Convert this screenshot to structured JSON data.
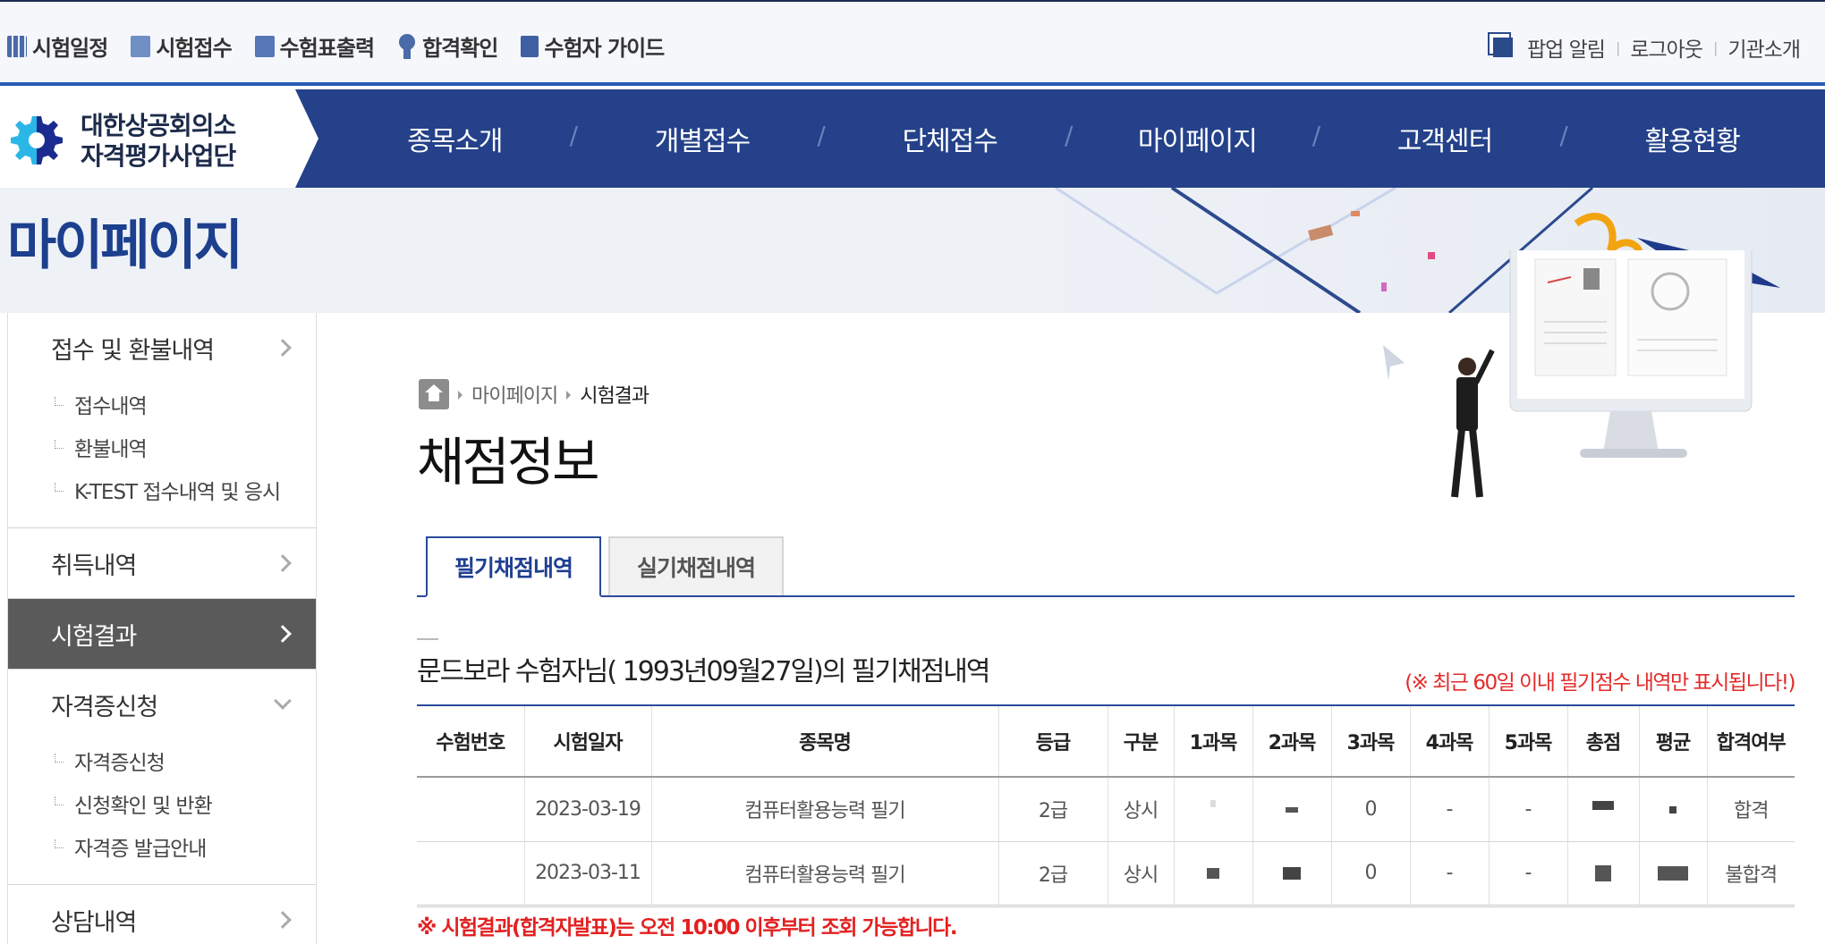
{
  "topbar": {
    "left_items": [
      {
        "label": "시험일정",
        "icon": "calendar-icon"
      },
      {
        "label": "시험접수",
        "icon": "pen-icon"
      },
      {
        "label": "수험표출력",
        "icon": "print-icon"
      },
      {
        "label": "합격확인",
        "icon": "ribbon-icon"
      },
      {
        "label": "수험자 가이드",
        "icon": "book-icon"
      }
    ],
    "right_items": [
      "팝업 알림",
      "로그아웃",
      "기관소개"
    ]
  },
  "logo": {
    "line1": "대한상공회의소",
    "line2": "자격평가사업단"
  },
  "gnb": [
    "종목소개",
    "개별접수",
    "단체접수",
    "마이페이지",
    "고객센터",
    "활용현황"
  ],
  "banner": {
    "title": "마이페이지"
  },
  "sidebar": {
    "sections": [
      {
        "label": "접수 및 환불내역",
        "subitems": [
          "접수내역",
          "환불내역",
          "K-TEST 접수내역 및 응시"
        ]
      },
      {
        "label": "취득내역"
      },
      {
        "label": "시험결과",
        "active": true
      },
      {
        "label": "자격증신청",
        "subitems": [
          "자격증신청",
          "신청확인 및 반환",
          "자격증 발급안내"
        ]
      },
      {
        "label": "상담내역"
      }
    ]
  },
  "breadcrumb": [
    "마이페이지",
    "시험결과"
  ],
  "page_title": "채점정보",
  "tabs": [
    "필기채점내역",
    "실기채점내역"
  ],
  "section_title": "문드보라 수험자님( 1993년09월27일)의 필기채점내역",
  "note": "(※ 최근 60일 이내 필기점수 내역만 표시됩니다!)",
  "table": {
    "headers": [
      "수험번호",
      "시험일자",
      "종목명",
      "등급",
      "구분",
      "1과목",
      "2과목",
      "3과목",
      "4과목",
      "5과목",
      "총점",
      "평균",
      "합격여부"
    ],
    "rows": [
      {
        "exam_no": "",
        "date": "2023-03-19",
        "name": "컴퓨터활용능력 필기",
        "grade": "2급",
        "type": "상시",
        "s3": "0",
        "s4": "-",
        "s5": "-",
        "result": "합격"
      },
      {
        "exam_no": "",
        "date": "2023-03-11",
        "name": "컴퓨터활용능력 필기",
        "grade": "2급",
        "type": "상시",
        "s3": "0",
        "s4": "-",
        "s5": "-",
        "result": "불합격"
      }
    ]
  },
  "footnote": "※ 시험결과(합격자발표)는 오전 10:00 이후부터 조회 가능합니다.",
  "colors": {
    "navy": "#244189",
    "accent": "#1e3f92",
    "alert": "#e32020",
    "sidebar_active": "#5a5a5a"
  }
}
